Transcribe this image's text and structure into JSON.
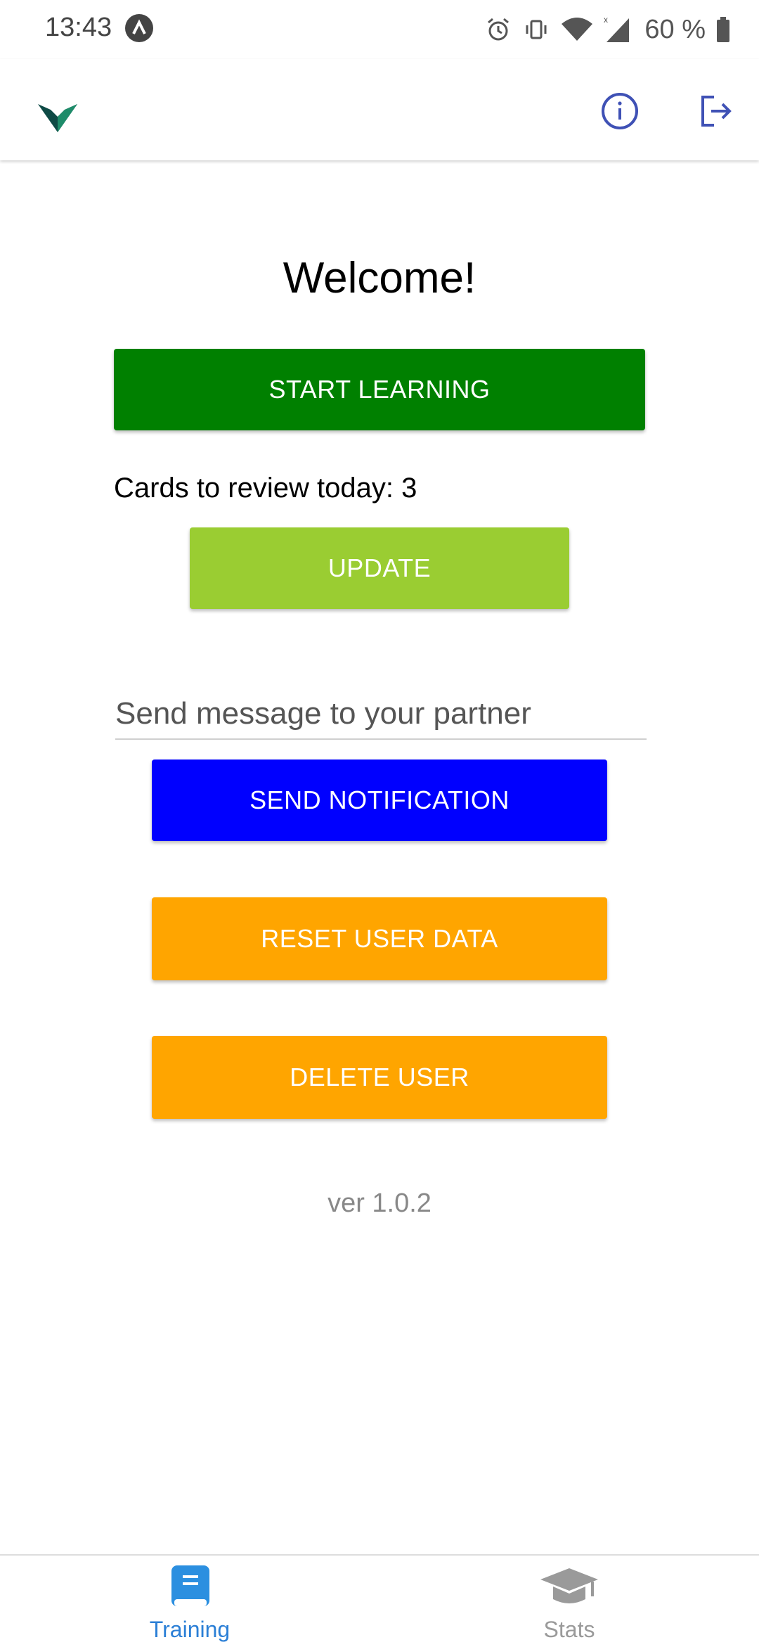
{
  "status_bar": {
    "time": "13:43",
    "battery": "60 %",
    "icons": [
      "app-icon",
      "alarm-icon",
      "vibrate-icon",
      "wifi-icon",
      "signal-icon",
      "battery-icon"
    ]
  },
  "app_bar": {
    "logo_icon": "app-logo",
    "actions": [
      "info-icon",
      "logout-icon"
    ],
    "accent_color": "#3f51b5"
  },
  "main": {
    "welcome": "Welcome!",
    "start_button": "START LEARNING",
    "cards_review": "Cards to review today: 3",
    "update_button": "UPDATE",
    "message_placeholder": "Send message to your partner",
    "message_value": "",
    "send_button": "SEND NOTIFICATION",
    "reset_button": "RESET USER DATA",
    "delete_button": "DELETE USER",
    "version": "ver 1.0.2",
    "colors": {
      "start": "#008000",
      "update": "#9acd32",
      "send": "#0000ff",
      "reset": "#ffa500",
      "delete": "#ffa500"
    }
  },
  "bottom_nav": {
    "tabs": [
      {
        "label": "Training",
        "icon": "book-icon",
        "active": true
      },
      {
        "label": "Stats",
        "icon": "graduation-cap-icon",
        "active": false
      }
    ],
    "active_color": "#2b7fd6"
  }
}
